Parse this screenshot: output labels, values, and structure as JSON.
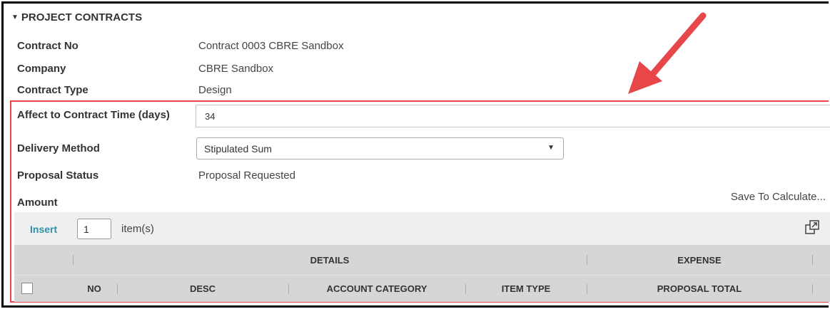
{
  "section": {
    "title": "PROJECT CONTRACTS"
  },
  "fields": {
    "contract_no": {
      "label": "Contract No",
      "value": "Contract 0003 CBRE Sandbox"
    },
    "company": {
      "label": "Company",
      "value": "CBRE Sandbox"
    },
    "contract_type": {
      "label": "Contract Type",
      "value": "Design"
    },
    "affect_time": {
      "label": "Affect to Contract Time (days)",
      "value": "34"
    },
    "delivery_method": {
      "label": "Delivery Method",
      "value": "Stipulated Sum"
    },
    "proposal_status": {
      "label": "Proposal Status",
      "value": "Proposal Requested"
    },
    "amount": {
      "label": "Amount",
      "action": "Save To Calculate..."
    }
  },
  "grid": {
    "insert_label": "Insert",
    "insert_count": "1",
    "items_label": "item(s)",
    "groups": {
      "details": "DETAILS",
      "expense": "EXPENSE"
    },
    "columns": {
      "no": "NO",
      "desc": "DESC",
      "account_category": "ACCOUNT CATEGORY",
      "item_type": "ITEM TYPE",
      "proposal_total": "PROPOSAL TOTAL"
    }
  },
  "colors": {
    "highlight": "#e8474a",
    "link": "#2f8fa6",
    "header_bg": "#d6d6d6",
    "toolbar_bg": "#efefef"
  }
}
